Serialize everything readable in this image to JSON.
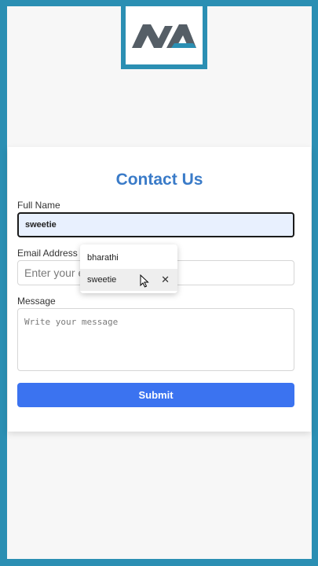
{
  "logo": {
    "text": "MA",
    "colors": {
      "dark": "#555e66",
      "accent": "#2b8fb3"
    }
  },
  "form": {
    "title": "Contact Us",
    "full_name": {
      "label": "Full Name",
      "value": "sweetie"
    },
    "email": {
      "label": "Email Address",
      "placeholder": "Enter your email"
    },
    "message": {
      "label": "Message",
      "placeholder": "Write your message"
    },
    "submit_label": "Submit"
  },
  "autocomplete": {
    "items": [
      {
        "label": "bharathi"
      },
      {
        "label": "sweetie",
        "close": "✕"
      }
    ]
  },
  "colors": {
    "frame": "#2b8fb3",
    "title": "#3a7bc8",
    "button": "#3b73f0"
  }
}
